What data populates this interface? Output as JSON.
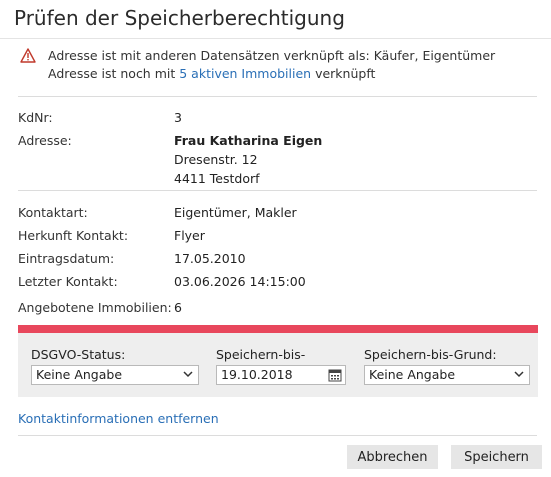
{
  "dialog": {
    "title": "Prüfen der Speicherberechtigung"
  },
  "warning": {
    "icon": "warning-triangle-icon",
    "color": "#c0392b",
    "line1": "Adresse ist mit anderen Datensätzen verknüpft als: Käufer, Eigentümer",
    "line2_prefix": "Adresse ist noch mit",
    "line2_link": "5 aktiven Immobilien",
    "line2_suffix": "verknüpft"
  },
  "details": {
    "kdnr_label": "KdNr:",
    "kdnr_value": "3",
    "adresse_label": "Adresse:",
    "adresse_name": "Frau Katharina Eigen",
    "adresse_street": "Dresenstr. 12",
    "adresse_city": "4411 Testdorf",
    "kontaktart_label": "Kontaktart:",
    "kontaktart_value": "Eigentümer, Makler",
    "herkunft_label": "Herkunft Kontakt:",
    "herkunft_value": "Flyer",
    "eintrag_label": "Eintragsdatum:",
    "eintrag_value": "17.05.2010",
    "letzter_label": "Letzter Kontakt:",
    "letzter_value": "03.06.2026 14:15:00",
    "angebotene_label": "Angebotene Immobilien:",
    "angebotene_value": "6"
  },
  "gdpr": {
    "accent_color": "#e8475c",
    "status_label": "DSGVO-Status:",
    "status_value": "Keine Angabe",
    "bis_label": "Speichern-bis-",
    "bis_value": "19.10.2018",
    "grund_label": "Speichern-bis-Grund:",
    "grund_value": "Keine Angabe"
  },
  "remove_link": "Kontaktinformationen entfernen",
  "buttons": {
    "cancel": "Abbrechen",
    "save": "Speichern"
  }
}
